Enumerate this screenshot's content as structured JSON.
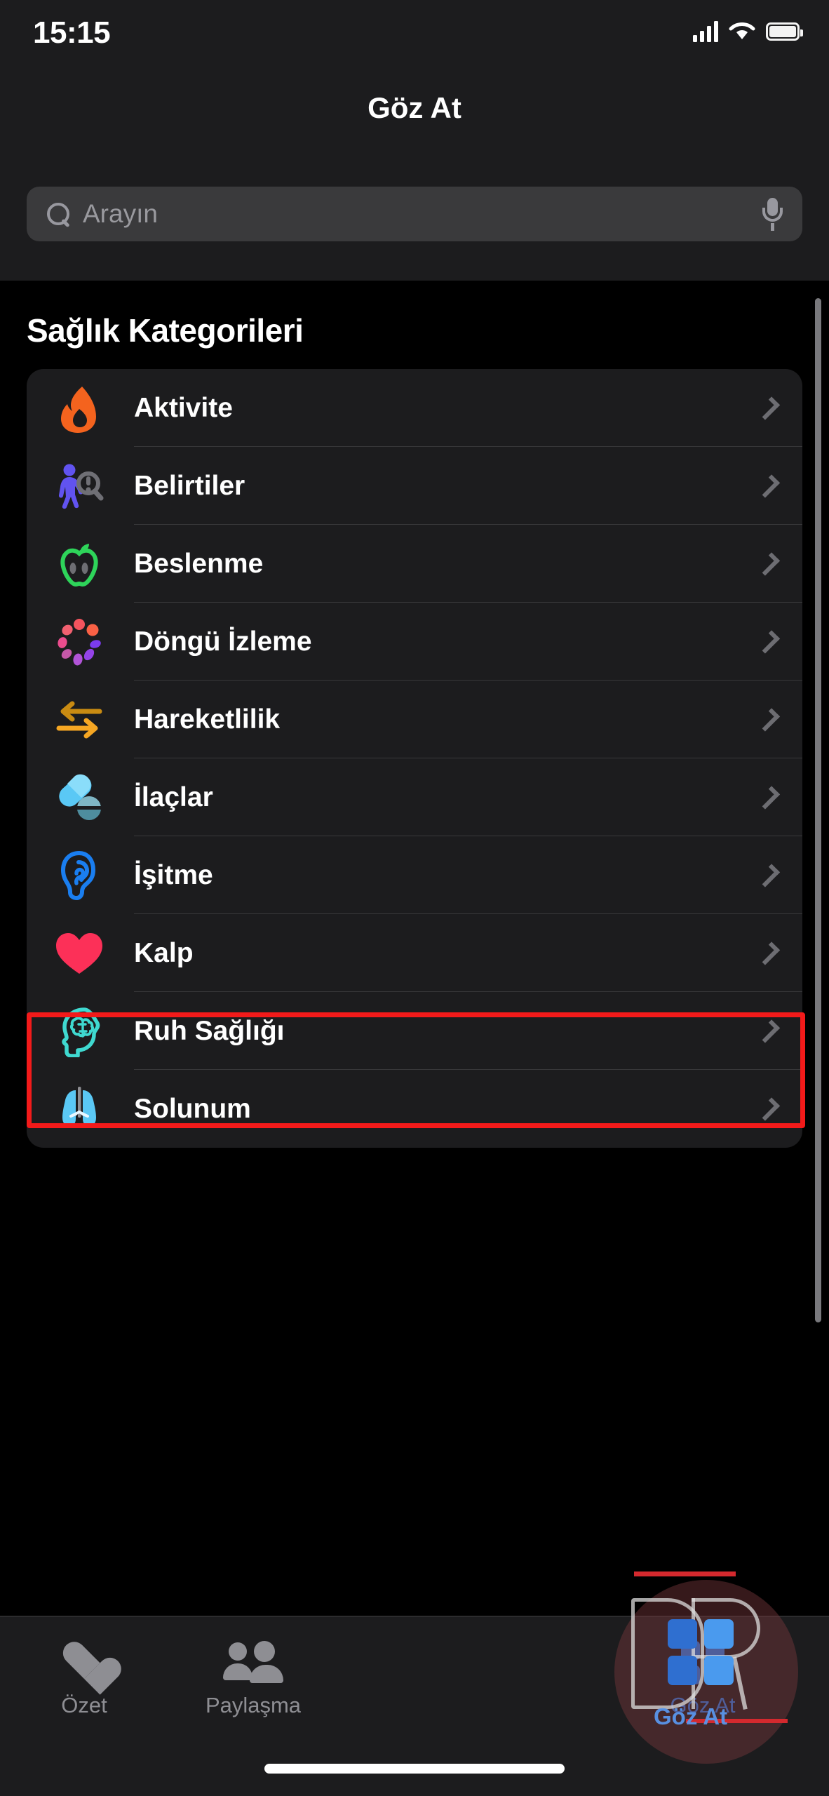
{
  "status_bar": {
    "time": "15:15",
    "cellular_icon": "signal-bars-icon",
    "wifi_icon": "wifi-icon",
    "battery_icon": "battery-icon"
  },
  "header": {
    "title": "Göz At"
  },
  "search": {
    "placeholder": "Arayın",
    "value": "",
    "search_icon": "search-icon",
    "mic_icon": "microphone-icon"
  },
  "main": {
    "section_title": "Sağlık Kategorileri",
    "rows": [
      {
        "label": "Aktivite",
        "icon": "flame-icon",
        "color": "#F4631E",
        "highlighted": false
      },
      {
        "label": "Belirtiler",
        "icon": "symptoms-icon",
        "color": "#6153F0",
        "highlighted": false
      },
      {
        "label": "Beslenme",
        "icon": "apple-icon",
        "color": "#2ED45A",
        "highlighted": false
      },
      {
        "label": "Döngü İzleme",
        "icon": "cycle-tracking-icon",
        "color": "#F3616B",
        "highlighted": false
      },
      {
        "label": "Hareketlilik",
        "icon": "mobility-arrows-icon",
        "color": "#F5A623",
        "highlighted": false
      },
      {
        "label": "İlaçlar",
        "icon": "pills-icon",
        "color": "#5AC8F5",
        "highlighted": true
      },
      {
        "label": "İşitme",
        "icon": "ear-icon",
        "color": "#1A7EF0",
        "highlighted": false
      },
      {
        "label": "Kalp",
        "icon": "heart-icon",
        "color": "#FC3058",
        "highlighted": false
      },
      {
        "label": "Ruh Sağlığı",
        "icon": "brain-head-icon",
        "color": "#3FD9D0",
        "highlighted": false
      },
      {
        "label": "Solunum",
        "icon": "lungs-icon",
        "color": "#5AC8F5",
        "highlighted": false
      }
    ],
    "chevron_icon": "chevron-right-icon",
    "highlight_color": "#F21A1A"
  },
  "tab_bar": {
    "tabs": [
      {
        "label": "Özet",
        "icon": "heart-filled-icon",
        "active": false
      },
      {
        "label": "Paylaşma",
        "icon": "two-people-icon",
        "active": false
      },
      {
        "label": "Göz At",
        "icon": "grid-squares-icon",
        "active": true
      }
    ],
    "active_color": "#2F7FE8",
    "inactive_color": "#8E8E93"
  },
  "watermark": {
    "text": "Göz At",
    "logo_letters": "DR",
    "accent_color": "#D4292E"
  }
}
